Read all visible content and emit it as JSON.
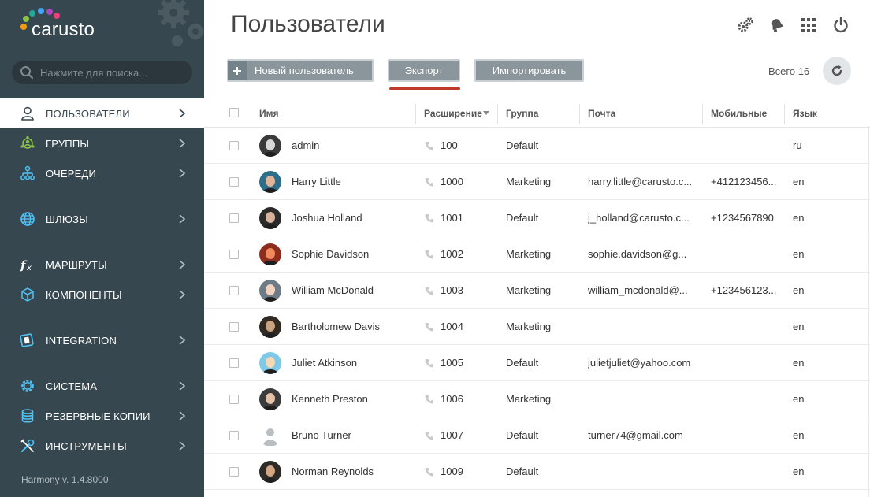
{
  "brand": {
    "name": "carusto"
  },
  "search": {
    "placeholder": "Нажмите для поиска..."
  },
  "sidebar": {
    "items": [
      {
        "label": "ПОЛЬЗОВАТЕЛИ",
        "icon": "user-icon",
        "active": true
      },
      {
        "label": "ГРУППЫ",
        "icon": "group-icon"
      },
      {
        "label": "ОЧЕРЕДИ",
        "icon": "queue-icon"
      },
      {
        "label": "ШЛЮЗЫ",
        "icon": "globe-icon"
      },
      {
        "label": "МАРШРУТЫ",
        "icon": "fx-icon"
      },
      {
        "label": "КОМПОНЕНТЫ",
        "icon": "cube-icon"
      },
      {
        "label": "INTEGRATION",
        "icon": "integration-icon"
      },
      {
        "label": "СИСТЕМА",
        "icon": "system-gear-icon"
      },
      {
        "label": "РЕЗЕРВНЫЕ КОПИИ",
        "icon": "database-icon"
      },
      {
        "label": "ИНСТРУМЕНТЫ",
        "icon": "tools-icon"
      }
    ],
    "version": "Harmony v. 1.4.8000"
  },
  "header": {
    "title": "Пользователи",
    "icons": [
      "settings-icon",
      "notifications-icon",
      "apps-grid-icon",
      "power-icon"
    ]
  },
  "toolbar": {
    "new_user_label": "Новый пользователь",
    "export_label": "Экспорт",
    "import_label": "Импортировать",
    "total_label": "Всего 16"
  },
  "table": {
    "columns": {
      "name": "Имя",
      "extension": "Расширение",
      "group": "Группа",
      "email": "Почта",
      "mobile": "Мобильные",
      "language": "Язык"
    },
    "rows": [
      {
        "name": "admin",
        "extension": "100",
        "group": "Default",
        "email": "",
        "mobile": "",
        "language": "ru"
      },
      {
        "name": "Harry Little",
        "extension": "1000",
        "group": "Marketing",
        "email": "harry.little@carusto.c...",
        "mobile": "+412123456...",
        "language": "en"
      },
      {
        "name": "Joshua Holland",
        "extension": "1001",
        "group": "Default",
        "email": "j_holland@carusto.c...",
        "mobile": "+1234567890",
        "language": "en"
      },
      {
        "name": "Sophie Davidson",
        "extension": "1002",
        "group": "Marketing",
        "email": "sophie.davidson@g...",
        "mobile": "",
        "language": "en"
      },
      {
        "name": "William McDonald",
        "extension": "1003",
        "group": "Marketing",
        "email": "william_mcdonald@...",
        "mobile": "+123456123...",
        "language": "en"
      },
      {
        "name": "Bartholomew Davis",
        "extension": "1004",
        "group": "Marketing",
        "email": "",
        "mobile": "",
        "language": "en"
      },
      {
        "name": "Juliet Atkinson",
        "extension": "1005",
        "group": "Default",
        "email": "julietjuliet@yahoo.com",
        "mobile": "",
        "language": "en"
      },
      {
        "name": "Kenneth Preston",
        "extension": "1006",
        "group": "Marketing",
        "email": "",
        "mobile": "",
        "language": "en"
      },
      {
        "name": "Bruno Turner",
        "extension": "1007",
        "group": "Default",
        "email": "turner74@gmail.com",
        "mobile": "",
        "language": "en"
      },
      {
        "name": "Norman Reynolds",
        "extension": "1009",
        "group": "Default",
        "email": "",
        "mobile": "",
        "language": "en"
      }
    ]
  },
  "colors": {
    "sidebar_bg": "#37474f",
    "button_bg": "#8a969c",
    "accent_underline": "#c0392b"
  }
}
